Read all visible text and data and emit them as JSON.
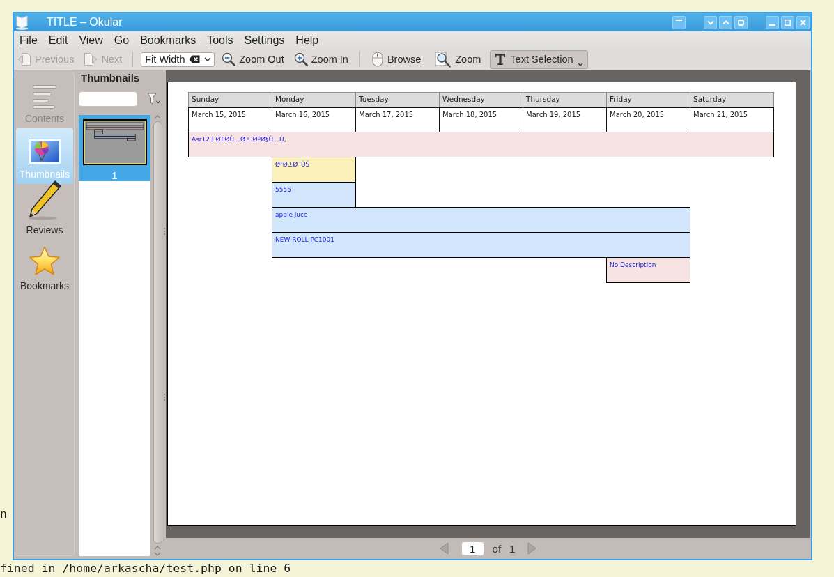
{
  "window": {
    "title": "TITLE – Okular"
  },
  "menu": [
    "File",
    "Edit",
    "View",
    "Go",
    "Bookmarks",
    "Tools",
    "Settings",
    "Help"
  ],
  "toolbar": {
    "nav": [
      {
        "kind": "previous",
        "label": "Previous",
        "disabled": true
      },
      {
        "kind": "next",
        "label": "Next",
        "disabled": true
      }
    ],
    "zoom_combo": {
      "value": "Fit Width"
    },
    "zoom_buttons": [
      {
        "kind": "zoom_out",
        "label": "Zoom Out"
      },
      {
        "kind": "zoom_in",
        "label": "Zoom In"
      }
    ],
    "modes": [
      {
        "kind": "browse",
        "label": "Browse",
        "selected": false
      },
      {
        "kind": "zoom",
        "label": "Zoom",
        "selected": false
      },
      {
        "kind": "text_selection",
        "label": "Text Selection",
        "selected": true
      }
    ]
  },
  "sidebar": {
    "tabs": [
      {
        "kind": "contents",
        "label": "Contents",
        "selected": false,
        "disabled": true
      },
      {
        "kind": "thumbnails",
        "label": "Thumbnails",
        "selected": true,
        "disabled": false
      },
      {
        "kind": "reviews",
        "label": "Reviews",
        "selected": false,
        "disabled": false
      },
      {
        "kind": "bookmarks",
        "label": "Bookmarks",
        "selected": false,
        "disabled": false
      }
    ]
  },
  "thumbnails_panel": {
    "title": "Thumbnails",
    "pages": [
      {
        "label": "1",
        "selected": true
      }
    ]
  },
  "document": {
    "calendar": {
      "columns": [
        {
          "day": "Sunday",
          "date": "March 15, 2015"
        },
        {
          "day": "Monday",
          "date": "March 16, 2015"
        },
        {
          "day": "Tuesday",
          "date": "March 17, 2015"
        },
        {
          "day": "Wednesday",
          "date": "March 18, 2015"
        },
        {
          "day": "Thursday",
          "date": "March 19, 2015"
        },
        {
          "day": "Friday",
          "date": "March 20, 2015"
        },
        {
          "day": "Saturday",
          "date": "March 21, 2015"
        }
      ],
      "event_rows": [
        {
          "slots": [
            {
              "kind": "event",
              "text": "Asr123 Ø£ØÙ…Ø± ØºØ§Ù…Ù‚",
              "color": "#f8e3e3"
            },
            {
              "kind": "continued"
            },
            {
              "kind": "continued"
            },
            {
              "kind": "continued"
            },
            {
              "kind": "continued"
            },
            {
              "kind": "continued"
            },
            {
              "kind": "continued"
            }
          ]
        },
        {
          "slots": [
            {
              "kind": "empty"
            },
            {
              "kind": "event",
              "text": "Ø¹Ø±Ø¨ÙŠ",
              "color": "#fcf0bb"
            },
            {
              "kind": "empty"
            },
            {
              "kind": "empty"
            },
            {
              "kind": "empty"
            },
            {
              "kind": "empty"
            },
            {
              "kind": "empty"
            }
          ]
        },
        {
          "slots": [
            {
              "kind": "empty"
            },
            {
              "kind": "event",
              "text": "5555",
              "color": "#d2e6fc"
            },
            {
              "kind": "empty"
            },
            {
              "kind": "empty"
            },
            {
              "kind": "empty"
            },
            {
              "kind": "empty"
            },
            {
              "kind": "empty"
            }
          ]
        },
        {
          "slots": [
            {
              "kind": "empty"
            },
            {
              "kind": "event",
              "text": "apple juce",
              "color": "#d2e6fc"
            },
            {
              "kind": "continued"
            },
            {
              "kind": "continued"
            },
            {
              "kind": "continued"
            },
            {
              "kind": "continued"
            },
            {
              "kind": "empty"
            }
          ]
        },
        {
          "slots": [
            {
              "kind": "empty"
            },
            {
              "kind": "event",
              "text": "NEW ROLL PC1001",
              "color": "#d2e6fc"
            },
            {
              "kind": "continued"
            },
            {
              "kind": "continued"
            },
            {
              "kind": "continued"
            },
            {
              "kind": "continued"
            },
            {
              "kind": "empty"
            }
          ]
        },
        {
          "slots": [
            {
              "kind": "empty"
            },
            {
              "kind": "empty"
            },
            {
              "kind": "empty"
            },
            {
              "kind": "empty"
            },
            {
              "kind": "empty"
            },
            {
              "kind": "event",
              "text": "No Description",
              "color": "#f8e3e3"
            },
            {
              "kind": "empty"
            }
          ]
        }
      ]
    }
  },
  "page_nav": {
    "page": "1",
    "of": "of",
    "total": "1"
  },
  "background_text": {
    "left_fragment": "n",
    "bottom_line": "fined in /home/arkascha/test.php on line 6"
  }
}
